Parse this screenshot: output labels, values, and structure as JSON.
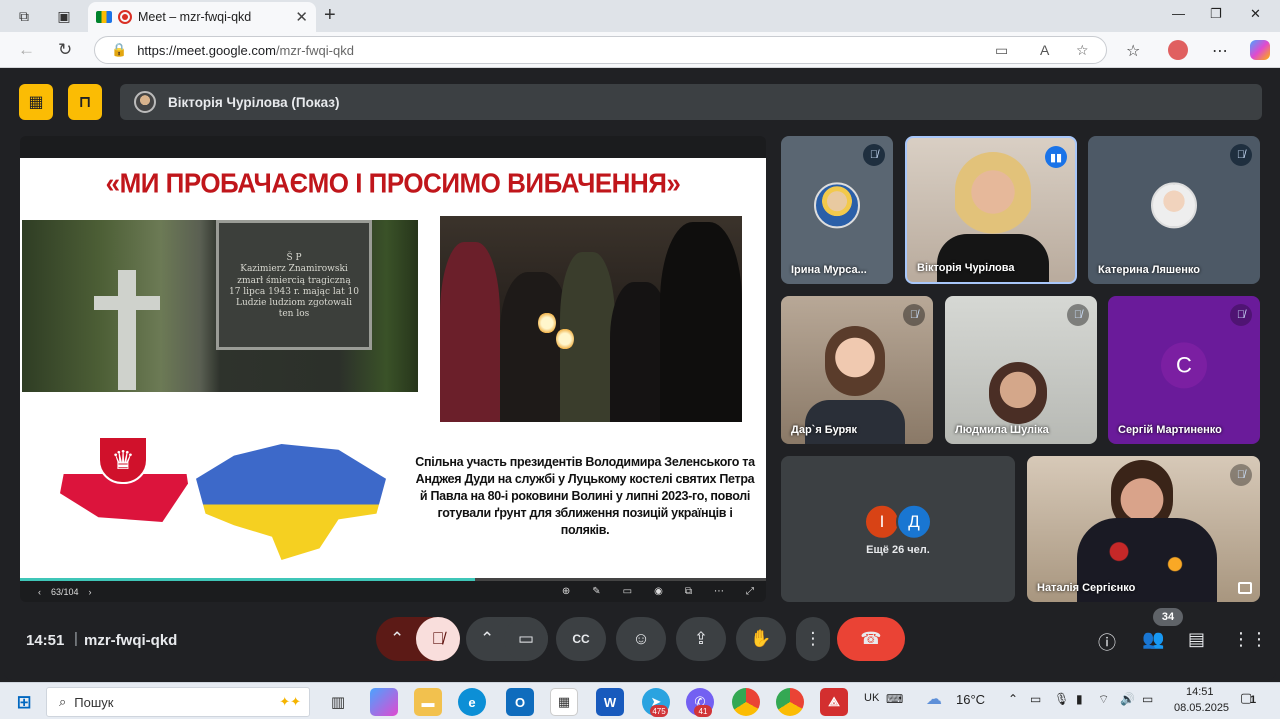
{
  "browser": {
    "tab_title": "Meet – mzr-fwqi-qkd",
    "url_host": "https://meet.google.com",
    "url_path": "/mzr-fwqi-qkd"
  },
  "meet": {
    "presenter_label": "Вікторія Чурілова (Показ)",
    "slide": {
      "title": "«МИ ПРОБАЧАЄМО І ПРОСИМО ВИБАЧЕННЯ»",
      "stone_text": "Š P\nKazimierz Znamirowski\nzmarł śmiercią tragiczną\n17 lipca 1943 r. mając lat 10\nLudzie ludziom zgotowali\nten los",
      "caption": "Спільна участь президентів Володимира Зеленського та Анджея Дуди на службі у Луцькому костелі святих Петра й Павла на 80-і роковини Волині у липні 2023-го, поволі готували ґрунт для зближення позицій українців і поляків.",
      "page_counter": "63/104",
      "progress": 0.61
    },
    "participants": [
      {
        "name": "Ірина Мурса..."
      },
      {
        "name": "Вікторія Чурілова"
      },
      {
        "name": "Катерина Ляшенко"
      },
      {
        "name": "Дар`я Буряк"
      },
      {
        "name": "Людмила Шуліка"
      },
      {
        "name": "Сергій Мартиненко",
        "initial": "С"
      },
      {
        "name": "Наталія Сергієнко"
      }
    ],
    "more": {
      "initials": [
        "І",
        "Д"
      ],
      "label": "Ещё 26 чел."
    },
    "clock": "14:51",
    "meeting_code": "mzr-fwqi-qkd",
    "participant_count": "34"
  },
  "taskbar": {
    "search_placeholder": "Пошук",
    "badge_telegram": "475",
    "badge_viber": "41",
    "lang": "UK",
    "temp": "16°C",
    "time": "14:51",
    "date": "08.05.2025",
    "notif_count": "1"
  },
  "colors": {
    "meet_bg": "#202124",
    "end_call": "#ea4335",
    "mic_off": "#f9dedc",
    "accent": "#fbbc04"
  }
}
